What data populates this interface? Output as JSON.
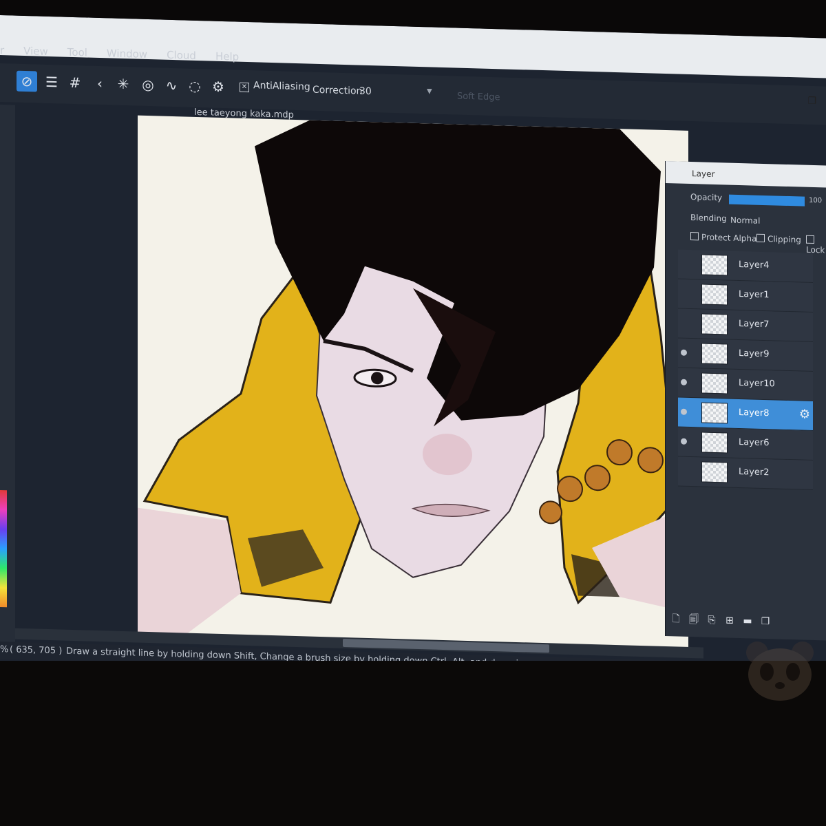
{
  "menu": [
    "r",
    "View",
    "Tool",
    "Window",
    "Cloud",
    "Help"
  ],
  "toolbar": {
    "antialiasing_label": "AntiAliasing",
    "correction_label": "Correction",
    "correction_value": "30",
    "soft_edge_label": "Soft Edge"
  },
  "document": {
    "title": "lee taeyong kaka.mdp"
  },
  "layer_panel": {
    "title": "Layer",
    "opacity_label": "Opacity",
    "opacity_value": "100",
    "opacity_fraction": 1.0,
    "blending_label": "Blending",
    "blending_value": "Normal",
    "protect_alpha_label": "Protect Alpha",
    "clipping_label": "Clipping",
    "lock_label": "Lock",
    "layers": [
      {
        "name": "Layer4",
        "visible": false,
        "selected": false
      },
      {
        "name": "Layer1",
        "visible": false,
        "selected": false
      },
      {
        "name": "Layer7",
        "visible": false,
        "selected": false
      },
      {
        "name": "Layer9",
        "visible": true,
        "selected": false
      },
      {
        "name": "Layer10",
        "visible": true,
        "selected": false
      },
      {
        "name": "Layer8",
        "visible": true,
        "selected": true
      },
      {
        "name": "Layer6",
        "visible": true,
        "selected": false
      },
      {
        "name": "Layer2",
        "visible": false,
        "selected": false
      }
    ]
  },
  "statusbar": {
    "zoom": "%",
    "coords": "( 635, 705 )",
    "hint": "Draw a straight line by holding down Shift, Change a brush size by holding down Ctrl, Alt, and dragging"
  },
  "colors": {
    "accent": "#2f7fd4",
    "jacket_yellow": "#e2b21a",
    "hair": "#0d0808",
    "skin": "#e9dbe4"
  }
}
